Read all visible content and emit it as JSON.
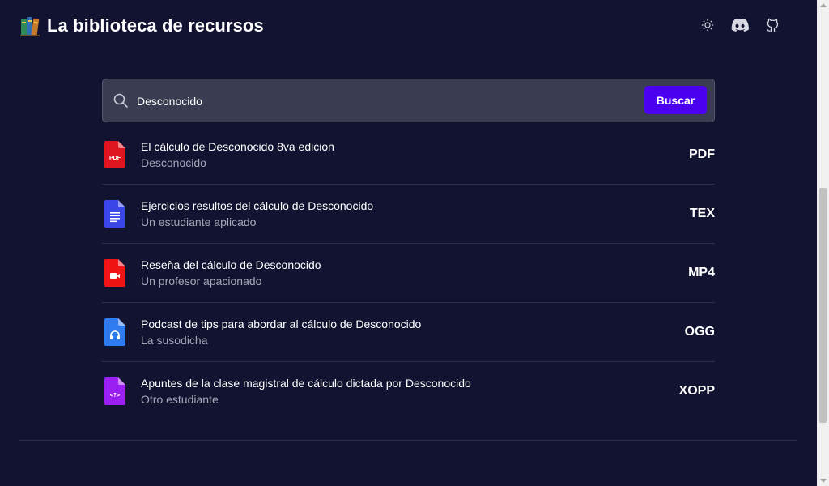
{
  "header": {
    "title": "La biblioteca de recursos",
    "logo_icon": "books-icon",
    "actions": [
      {
        "name": "theme-toggle",
        "icon": "sun-icon"
      },
      {
        "name": "discord-link",
        "icon": "discord-icon"
      },
      {
        "name": "github-link",
        "icon": "github-icon"
      }
    ]
  },
  "search": {
    "value": "Desconocido",
    "placeholder": "",
    "button_label": "Buscar",
    "icon": "search-icon"
  },
  "results": [
    {
      "title": "El cálculo de Desconocido 8va edicion",
      "author": "Desconocido",
      "ext": "PDF",
      "icon": "pdf-file-icon",
      "color": "#e0141e"
    },
    {
      "title": "Ejercicios resultos del cálculo de Desconocido",
      "author": "Un estudiante aplicado",
      "ext": "TEX",
      "icon": "document-file-icon",
      "color": "#3b46e8"
    },
    {
      "title": "Reseña del cálculo de Desconocido",
      "author": "Un profesor apacionado",
      "ext": "MP4",
      "icon": "video-file-icon",
      "color": "#f01414"
    },
    {
      "title": "Podcast de tips para abordar al cálculo de Desconocido",
      "author": "La susodicha",
      "ext": "OGG",
      "icon": "audio-file-icon",
      "color": "#2f7cf0"
    },
    {
      "title": "Apuntes de la clase magistral de cálculo dictada por Desconocido",
      "author": "Otro estudiante",
      "ext": "XOPP",
      "icon": "code-file-icon",
      "color": "#9b1ff0"
    }
  ],
  "colors": {
    "background": "#111331",
    "accent": "#4c00f0",
    "search_bg": "#3a3d52",
    "muted_text": "#a6a8b8"
  }
}
